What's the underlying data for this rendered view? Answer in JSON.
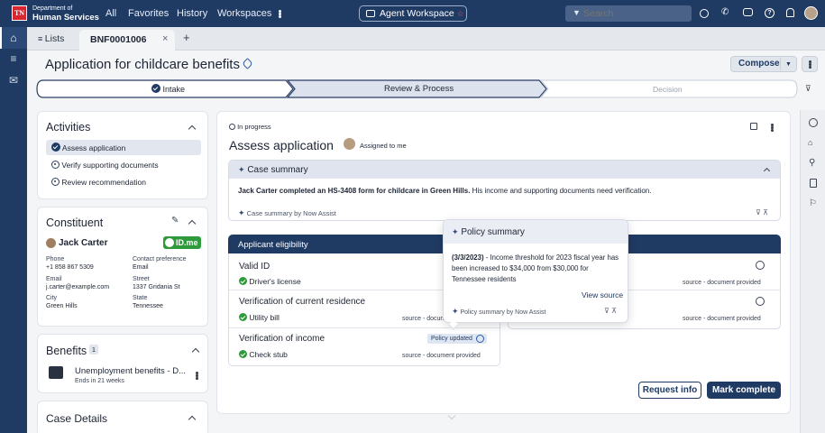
{
  "topnav": {
    "logo_badge": "TN",
    "org_line1": "Department of",
    "org_line2": "Human Services",
    "links": [
      "All",
      "Favorites",
      "History",
      "Workspaces"
    ],
    "workspace_label": "Agent Workspace",
    "search_placeholder": "Search"
  },
  "tabs": {
    "lists_label": "Lists",
    "active_tab": "BNF0001006"
  },
  "header": {
    "title": "Application for childcare benefits",
    "compose_label": "Compose"
  },
  "stages": {
    "items": [
      {
        "label": "Intake",
        "state": "done"
      },
      {
        "label": "Review & Process",
        "state": "current"
      },
      {
        "label": "Decision",
        "state": "upcoming"
      }
    ]
  },
  "activities": {
    "title": "Activities",
    "items": [
      {
        "label": "Assess application",
        "active": true
      },
      {
        "label": "Verify supporting documents",
        "active": false
      },
      {
        "label": "Review recommendation",
        "active": false
      }
    ]
  },
  "constituent": {
    "title": "Constituent",
    "name": "Jack Carter",
    "badge": "ID.me",
    "fields": {
      "phone_label": "Phone",
      "phone": "+1 858 867 5309",
      "contact_label": "Contact preference",
      "contact": "Email",
      "email_label": "Email",
      "email": "j.carter@example.com",
      "street_label": "Street",
      "street": "1337 Gridania St",
      "city_label": "City",
      "city": "Green Hills",
      "state_label": "State",
      "state": "Tennessee"
    }
  },
  "benefits": {
    "title": "Benefits",
    "count": "1",
    "item_title": "Unemployment benefits - D...",
    "item_sub": "Ends in 21 weeks"
  },
  "case_details": {
    "title": "Case Details"
  },
  "main": {
    "status": "In progress",
    "title": "Assess application",
    "assigned": "Assigned to me",
    "case_summary_title": "Case summary",
    "summary_bold": "Jack Carter completed an HS-3408 form for childcare in Green Hills.",
    "summary_rest": " His income and supporting documents need verification.",
    "summary_source": "Case summary by Now Assist",
    "eligibility_title": "Applicant eligibility",
    "rows_left": [
      {
        "title": "Valid ID",
        "doc": "Driver's license",
        "source": ""
      },
      {
        "title": "Verification of current residence",
        "doc": "Utility bill",
        "source": "source - docum"
      },
      {
        "title": "Verification of income",
        "doc": "Check stub",
        "source": "source - document provided"
      }
    ],
    "policy_badge": "Policy updated",
    "right_sources": [
      "source - document provided",
      "source - document provided"
    ],
    "request_info": "Request info",
    "mark_complete": "Mark complete"
  },
  "popover": {
    "title": "Policy summary",
    "date": "(3/3/2023)",
    "text": " - Income threshold for 2023 fiscal year has been increased to $34,000 from $30,000 for Tennessee residents",
    "view_source": "View source",
    "footer": "Policy summary by Now Assist"
  },
  "colors": {
    "navy": "#1f3a63",
    "accent_blue": "#2f5aa8",
    "success": "#2e9a3c",
    "logo_red": "#d8262f"
  }
}
